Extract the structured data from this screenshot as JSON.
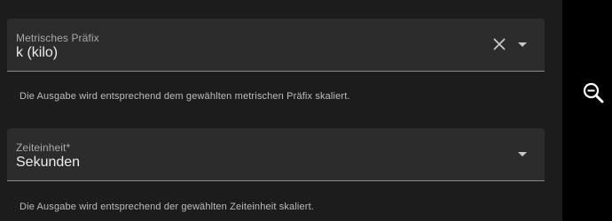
{
  "fields": {
    "metric_prefix": {
      "label": "Metrisches Präfix",
      "value": "k (kilo)",
      "helper": "Die Ausgabe wird entsprechend dem gewählten metrischen Präfix skaliert."
    },
    "time_unit": {
      "label": "Zeiteinheit*",
      "value": "Sekunden",
      "helper": "Die Ausgabe wird entsprechend der gewählten Zeiteinheit skaliert."
    }
  },
  "icons": {
    "clear": "close-icon",
    "dropdown": "chevron-down-icon",
    "zoom": "zoom-out-icon"
  },
  "colors": {
    "panel_background": "#1c1c1c",
    "field_background": "#2c2c2c",
    "text_primary": "#ececec",
    "text_secondary": "#a9a9a9"
  }
}
